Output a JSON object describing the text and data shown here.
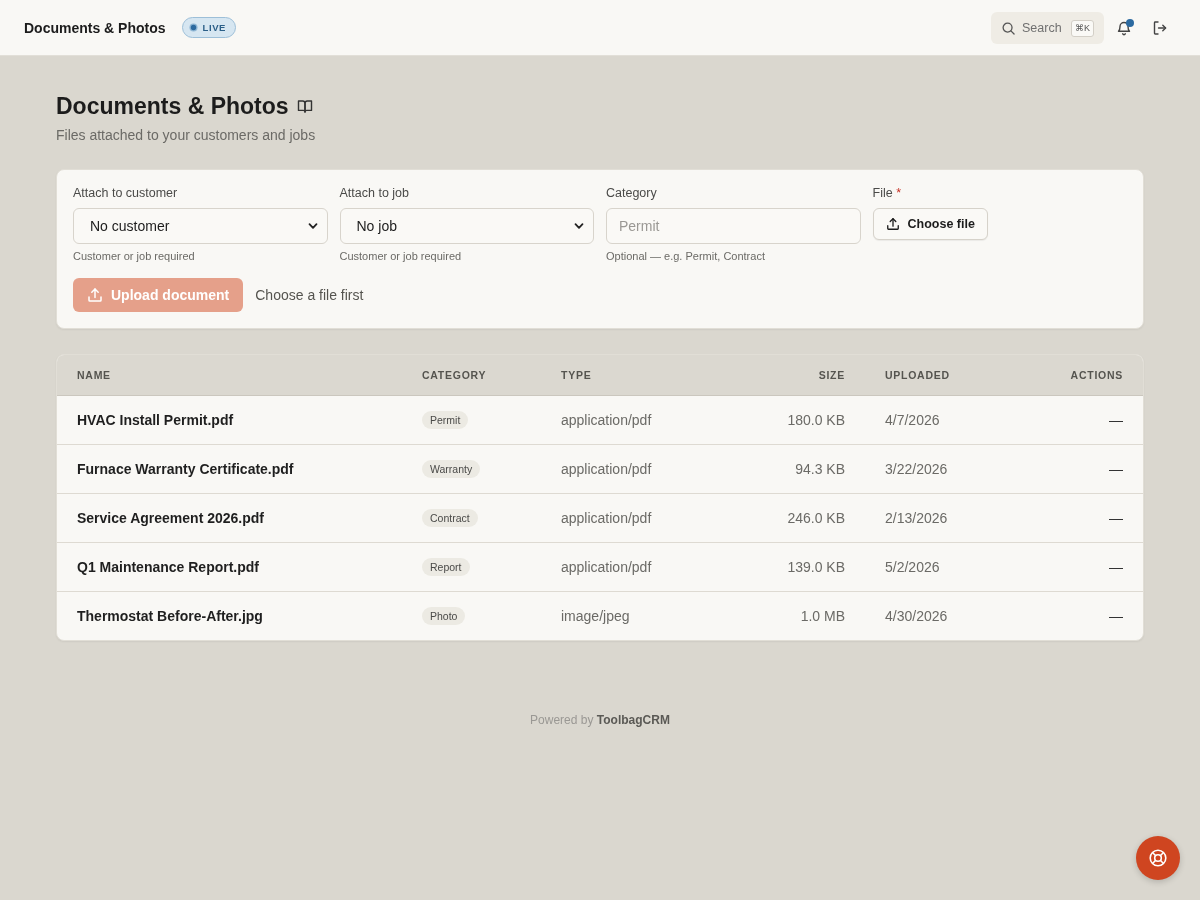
{
  "header": {
    "title": "Documents & Photos",
    "badge": "LIVE",
    "search": {
      "placeholder": "Search",
      "shortcut": "⌘K"
    },
    "notifications": {
      "unread": true
    }
  },
  "page": {
    "title": "Documents & Photos",
    "subtitle": "Files attached to your customers and jobs"
  },
  "form": {
    "fields": [
      {
        "kind": "select",
        "label": "Attach to customer",
        "value": "No customer",
        "hint": "Customer or job required"
      },
      {
        "kind": "select",
        "label": "Attach to job",
        "value": "No job",
        "hint": "Customer or job required"
      },
      {
        "kind": "text",
        "label": "Category",
        "placeholder": "Permit",
        "hint": "Optional — e.g. Permit, Contract"
      },
      {
        "kind": "file",
        "label": "File",
        "required_mark": "*",
        "button": "Choose file"
      }
    ],
    "submit": {
      "label": "Upload document",
      "disabled": true
    },
    "status": "Choose a file first"
  },
  "table": {
    "columns": [
      "NAME",
      "CATEGORY",
      "TYPE",
      "SIZE",
      "UPLOADED",
      "ACTIONS"
    ],
    "rows": [
      {
        "name": "HVAC Install Permit.pdf",
        "category": "Permit",
        "type": "application/pdf",
        "size": "180.0 KB",
        "uploaded": "4/7/2026",
        "actions": "—"
      },
      {
        "name": "Furnace Warranty Certificate.pdf",
        "category": "Warranty",
        "type": "application/pdf",
        "size": "94.3 KB",
        "uploaded": "3/22/2026",
        "actions": "—"
      },
      {
        "name": "Service Agreement 2026.pdf",
        "category": "Contract",
        "type": "application/pdf",
        "size": "246.0 KB",
        "uploaded": "2/13/2026",
        "actions": "—"
      },
      {
        "name": "Q1 Maintenance Report.pdf",
        "category": "Report",
        "type": "application/pdf",
        "size": "139.0 KB",
        "uploaded": "5/2/2026",
        "actions": "—"
      },
      {
        "name": "Thermostat Before-After.jpg",
        "category": "Photo",
        "type": "image/jpeg",
        "size": "1.0 MB",
        "uploaded": "4/30/2026",
        "actions": "—"
      }
    ]
  },
  "footer": "Powered by **ToolbagCRM**"
}
